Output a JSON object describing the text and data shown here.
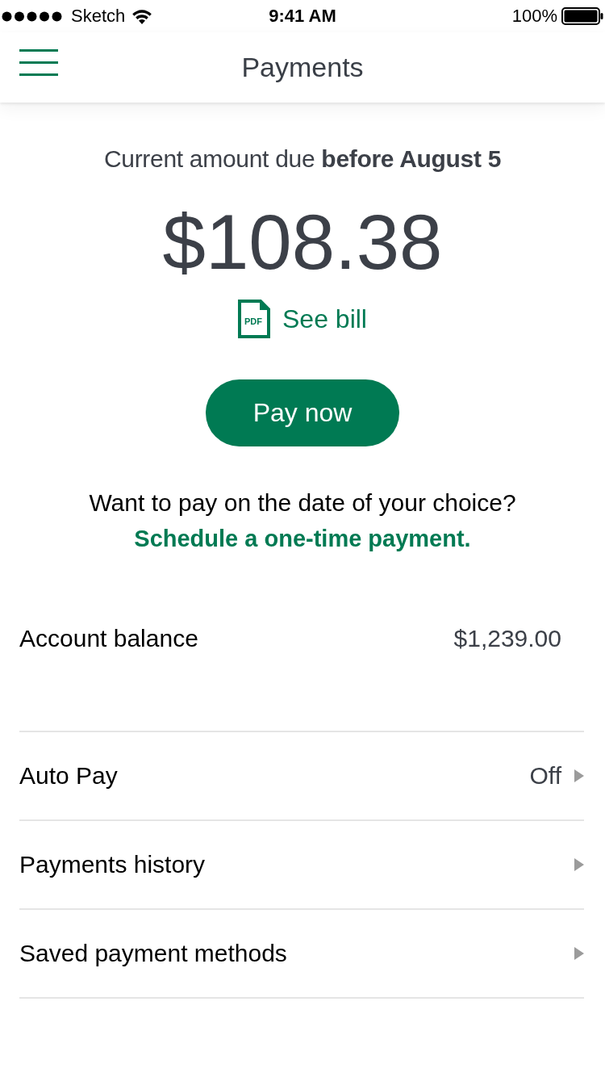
{
  "status_bar": {
    "carrier": "Sketch",
    "time": "9:41 AM",
    "battery": "100%"
  },
  "nav_bar": {
    "title": "Payments"
  },
  "amount_due": {
    "label": "Current amount due **before August 5**",
    "amount": "$108.38"
  },
  "see_bill": {
    "file_label": "PDF",
    "label": "See bill"
  },
  "pay_button": {
    "label": "Pay now"
  },
  "schedule": {
    "question": "Want to pay on the date of your choice?",
    "link": "Schedule a one-time payment."
  },
  "balance": {
    "label": "Account balance",
    "value": "$1,239.00"
  },
  "menu_items": [
    {
      "label": "Auto Pay",
      "value": "Off"
    },
    {
      "label": "Payments history"
    },
    {
      "label": "Saved payment methods"
    }
  ]
}
